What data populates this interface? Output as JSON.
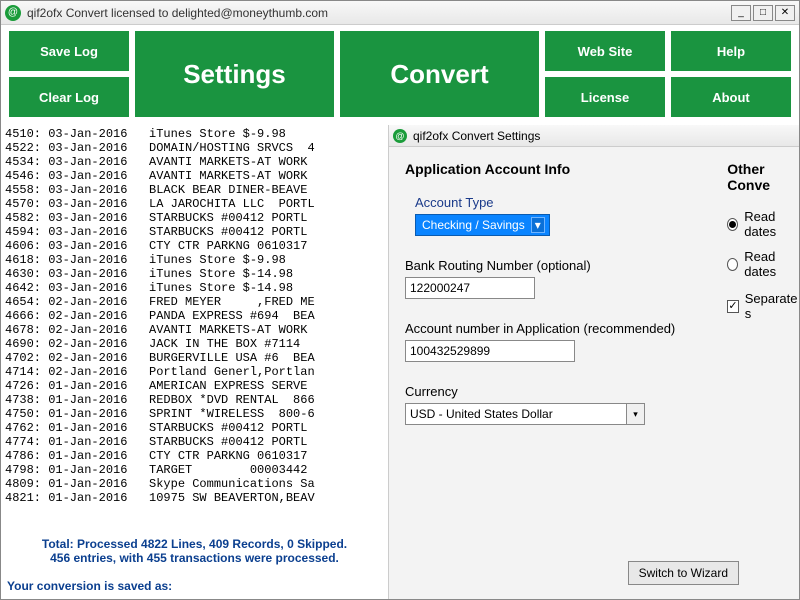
{
  "titlebar": {
    "text": "qif2ofx Convert licensed to delighted@moneythumb.com"
  },
  "toolbar": {
    "save_log": "Save Log",
    "clear_log": "Clear Log",
    "settings": "Settings",
    "convert": "Convert",
    "web_site": "Web Site",
    "help": "Help",
    "license": "License",
    "about": "About"
  },
  "log": {
    "lines": [
      {
        "n": "4510:",
        "d": "03-Jan-2016",
        "t": "iTunes Store $-9.98"
      },
      {
        "n": "4522:",
        "d": "03-Jan-2016",
        "t": "DOMAIN/HOSTING SRVCS  4"
      },
      {
        "n": "4534:",
        "d": "03-Jan-2016",
        "t": "AVANTI MARKETS-AT WORK"
      },
      {
        "n": "4546:",
        "d": "03-Jan-2016",
        "t": "AVANTI MARKETS-AT WORK"
      },
      {
        "n": "4558:",
        "d": "03-Jan-2016",
        "t": "BLACK BEAR DINER-BEAVE"
      },
      {
        "n": "4570:",
        "d": "03-Jan-2016",
        "t": "LA JAROCHITA LLC  PORTL"
      },
      {
        "n": "4582:",
        "d": "03-Jan-2016",
        "t": "STARBUCKS #00412 PORTL"
      },
      {
        "n": "4594:",
        "d": "03-Jan-2016",
        "t": "STARBUCKS #00412 PORTL"
      },
      {
        "n": "4606:",
        "d": "03-Jan-2016",
        "t": "CTY CTR PARKNG 0610317"
      },
      {
        "n": "4618:",
        "d": "03-Jan-2016",
        "t": "iTunes Store $-9.98"
      },
      {
        "n": "4630:",
        "d": "03-Jan-2016",
        "t": "iTunes Store $-14.98"
      },
      {
        "n": "4642:",
        "d": "03-Jan-2016",
        "t": "iTunes Store $-14.98"
      },
      {
        "n": "4654:",
        "d": "02-Jan-2016",
        "t": "FRED MEYER     ,FRED ME"
      },
      {
        "n": "4666:",
        "d": "02-Jan-2016",
        "t": "PANDA EXPRESS #694  BEA"
      },
      {
        "n": "4678:",
        "d": "02-Jan-2016",
        "t": "AVANTI MARKETS-AT WORK"
      },
      {
        "n": "4690:",
        "d": "02-Jan-2016",
        "t": "JACK IN THE BOX #7114"
      },
      {
        "n": "4702:",
        "d": "02-Jan-2016",
        "t": "BURGERVILLE USA #6  BEA"
      },
      {
        "n": "4714:",
        "d": "02-Jan-2016",
        "t": "Portland Generl,Portlan"
      },
      {
        "n": "4726:",
        "d": "01-Jan-2016",
        "t": "AMERICAN EXPRESS SERVE"
      },
      {
        "n": "4738:",
        "d": "01-Jan-2016",
        "t": "REDBOX *DVD RENTAL  866"
      },
      {
        "n": "4750:",
        "d": "01-Jan-2016",
        "t": "SPRINT *WIRELESS  800-6"
      },
      {
        "n": "4762:",
        "d": "01-Jan-2016",
        "t": "STARBUCKS #00412 PORTL"
      },
      {
        "n": "4774:",
        "d": "01-Jan-2016",
        "t": "STARBUCKS #00412 PORTL"
      },
      {
        "n": "4786:",
        "d": "01-Jan-2016",
        "t": "CTY CTR PARKNG 0610317"
      },
      {
        "n": "4798:",
        "d": "01-Jan-2016",
        "t": "TARGET        00003442"
      },
      {
        "n": "4809:",
        "d": "01-Jan-2016",
        "t": "Skype Communications Sa"
      },
      {
        "n": "4821:",
        "d": "01-Jan-2016",
        "t": "10975 SW BEAVERTON,BEAV"
      }
    ],
    "summary1": "Total: Processed 4822 Lines, 409 Records, 0 Skipped.",
    "summary2": "456 entries, with 455 transactions were processed.",
    "saved_as": "Your conversion is saved as:"
  },
  "settings": {
    "window_title": "qif2ofx Convert Settings",
    "left_header": "Application Account Info",
    "account_type_label": "Account Type",
    "account_type_value": "Checking / Savings",
    "routing_label": "Bank Routing Number (optional)",
    "routing_value": "122000247",
    "acctnum_label": "Account number in Application (recommended)",
    "acctnum_value": "100432529899",
    "currency_label": "Currency",
    "currency_value": "USD - United States Dollar",
    "right_header": "Other Conve",
    "radio1": "Read dates",
    "radio2": "Read dates",
    "check1": "Separate s",
    "wizard": "Switch to Wizard"
  }
}
